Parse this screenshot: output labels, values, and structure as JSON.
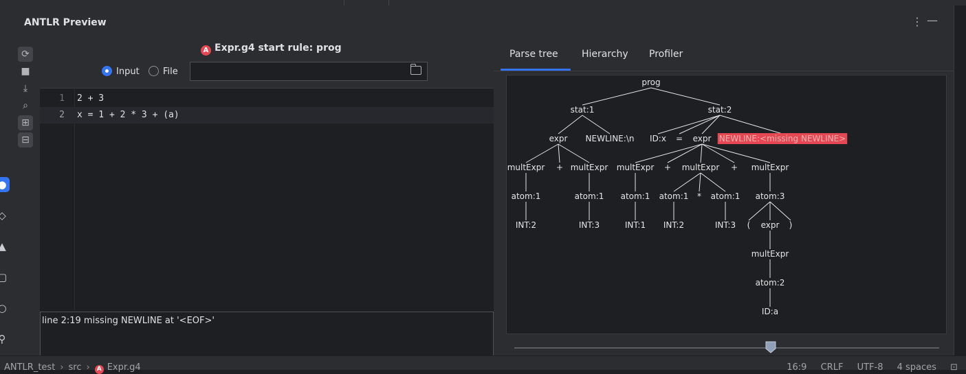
{
  "tool_window": {
    "title": "ANTLR Preview"
  },
  "header": {
    "start_rule": "Expr.g4 start rule: prog",
    "radio_input_label": "Input",
    "radio_file_label": "File",
    "selected": "Input"
  },
  "editor": {
    "lines": [
      {
        "number": "1",
        "text": "2 + 3"
      },
      {
        "number": "2",
        "text": "x = 1 + 2 * 3 + (a)"
      }
    ]
  },
  "console": {
    "message": "line 2:19 missing NEWLINE at '<EOF>'"
  },
  "tabs": [
    "Parse tree",
    "Hierarchy",
    "Profiler"
  ],
  "active_tab": "Parse tree",
  "parse_tree": {
    "nodes": [
      {
        "id": "prog",
        "label": "prog"
      },
      {
        "id": "stat1",
        "label": "stat:1"
      },
      {
        "id": "stat2",
        "label": "stat:2"
      },
      {
        "id": "expr_a",
        "label": "expr"
      },
      {
        "id": "nl1",
        "label": "NEWLINE:\\n"
      },
      {
        "id": "idx",
        "label": "ID:x"
      },
      {
        "id": "eq",
        "label": "="
      },
      {
        "id": "expr_b",
        "label": "expr"
      },
      {
        "id": "nl_missing",
        "label": "NEWLINE:<missing NEWLINE>",
        "error": true
      },
      {
        "id": "me1",
        "label": "multExpr"
      },
      {
        "id": "plus1",
        "label": "+"
      },
      {
        "id": "me2",
        "label": "multExpr"
      },
      {
        "id": "me3",
        "label": "multExpr"
      },
      {
        "id": "plus2",
        "label": "+"
      },
      {
        "id": "me4",
        "label": "multExpr"
      },
      {
        "id": "plus3",
        "label": "+"
      },
      {
        "id": "me5",
        "label": "multExpr"
      },
      {
        "id": "at1",
        "label": "atom:1"
      },
      {
        "id": "at2",
        "label": "atom:1"
      },
      {
        "id": "at3",
        "label": "atom:1"
      },
      {
        "id": "at4",
        "label": "atom:1"
      },
      {
        "id": "star",
        "label": "*"
      },
      {
        "id": "at5",
        "label": "atom:1"
      },
      {
        "id": "at6",
        "label": "atom:3"
      },
      {
        "id": "int2a",
        "label": "INT:2"
      },
      {
        "id": "int3a",
        "label": "INT:3"
      },
      {
        "id": "int1",
        "label": "INT:1"
      },
      {
        "id": "int2b",
        "label": "INT:2"
      },
      {
        "id": "int3b",
        "label": "INT:3"
      },
      {
        "id": "lp",
        "label": "("
      },
      {
        "id": "expr_c",
        "label": "expr"
      },
      {
        "id": "rp",
        "label": ")"
      },
      {
        "id": "me6",
        "label": "multExpr"
      },
      {
        "id": "at7",
        "label": "atom:2"
      },
      {
        "id": "ida",
        "label": "ID:a"
      }
    ],
    "edges": [
      [
        "prog",
        "stat1"
      ],
      [
        "prog",
        "stat2"
      ],
      [
        "stat1",
        "expr_a"
      ],
      [
        "stat1",
        "nl1"
      ],
      [
        "stat2",
        "idx"
      ],
      [
        "stat2",
        "eq"
      ],
      [
        "stat2",
        "expr_b"
      ],
      [
        "stat2",
        "nl_missing"
      ],
      [
        "expr_a",
        "me1"
      ],
      [
        "expr_a",
        "plus1"
      ],
      [
        "expr_a",
        "me2"
      ],
      [
        "expr_b",
        "me3"
      ],
      [
        "expr_b",
        "plus2"
      ],
      [
        "expr_b",
        "me4"
      ],
      [
        "expr_b",
        "plus3"
      ],
      [
        "expr_b",
        "me5"
      ],
      [
        "me1",
        "at1"
      ],
      [
        "me2",
        "at2"
      ],
      [
        "me3",
        "at3"
      ],
      [
        "me4",
        "at4"
      ],
      [
        "me4",
        "star"
      ],
      [
        "me4",
        "at5"
      ],
      [
        "me5",
        "at6"
      ],
      [
        "at1",
        "int2a"
      ],
      [
        "at2",
        "int3a"
      ],
      [
        "at3",
        "int1"
      ],
      [
        "at4",
        "int2b"
      ],
      [
        "at5",
        "int3b"
      ],
      [
        "at6",
        "lp"
      ],
      [
        "at6",
        "expr_c"
      ],
      [
        "at6",
        "rp"
      ],
      [
        "expr_c",
        "me6"
      ],
      [
        "me6",
        "at7"
      ],
      [
        "at7",
        "ida"
      ]
    ]
  },
  "zoom_slider": {
    "value_fraction": 0.57
  },
  "status_bar": {
    "breadcrumb": [
      "ANTLR_test",
      "src",
      "Expr.g4"
    ],
    "position": "16:9",
    "line_separator": "CRLF",
    "encoding": "UTF-8",
    "indent": "4 spaces"
  },
  "colors": {
    "accent": "#3574f0",
    "error_highlight": "#e54853",
    "antlr_badge": "#e54853"
  }
}
